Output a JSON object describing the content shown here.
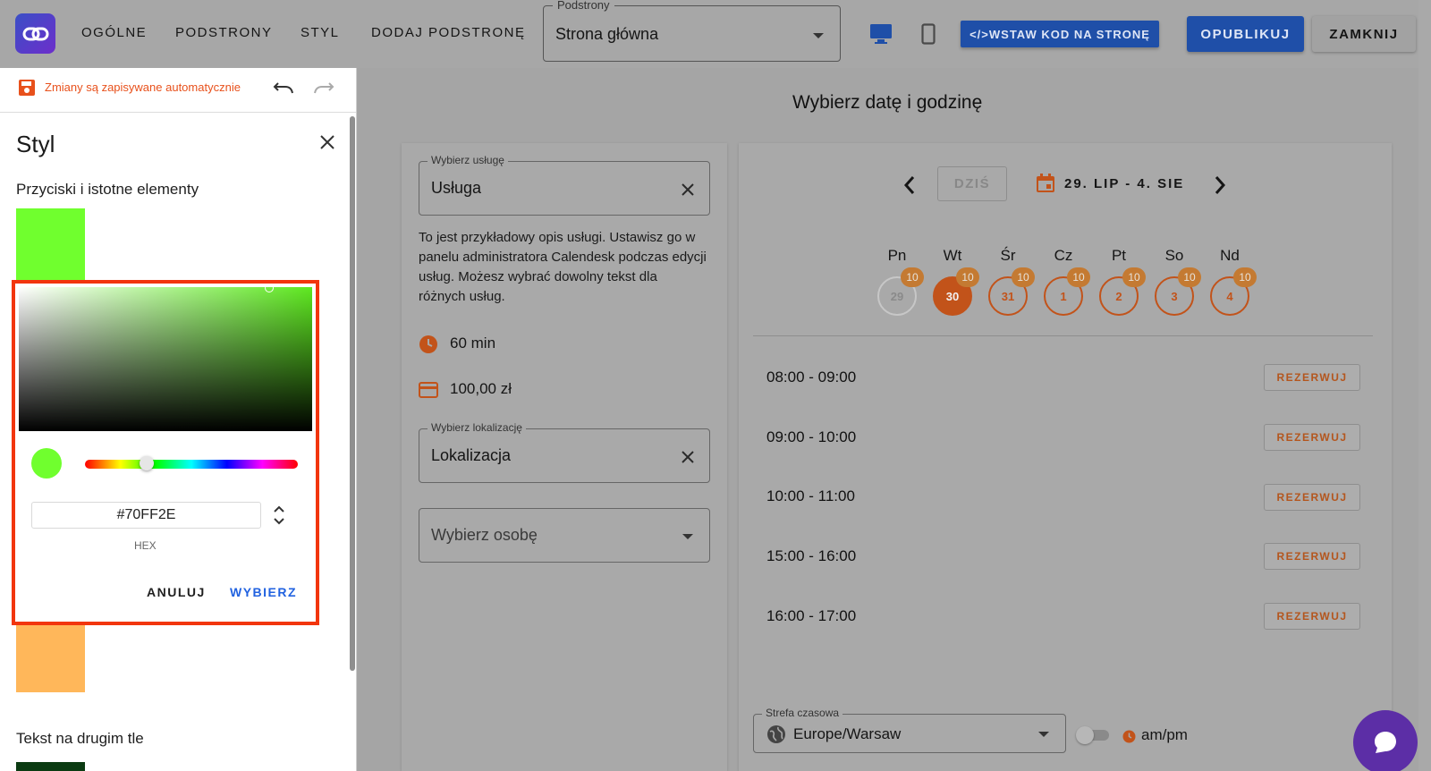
{
  "topbar": {
    "nav": [
      "OGÓLNE",
      "PODSTRONY",
      "STYL",
      "DODAJ PODSTRONĘ"
    ],
    "pages_select": {
      "legend": "Podstrony",
      "value": "Strona główna"
    },
    "embed_label": "</>WSTAW KOD NA STRONĘ",
    "publish_label": "OPUBLIKUJ",
    "close_label": "ZAMKNIJ"
  },
  "left_panel": {
    "autosave_text": "Zmiany są zapisywane automatycznie",
    "title": "Styl",
    "section1_label": "Przyciski i istotne elementy",
    "section2_label": "Tekst na drugim tle",
    "swatch_colors": {
      "primary": "#70ff2e",
      "secondary": "#ffb75a",
      "text_bg": "#0b3b12"
    }
  },
  "color_picker": {
    "hex_value": "#70FF2E",
    "hex_label": "HEX",
    "cancel_label": "ANULUJ",
    "select_label": "WYBIERZ"
  },
  "main": {
    "title": "Wybierz datę i godzinę",
    "service_select": {
      "legend": "Wybierz usługę",
      "value": "Usługa"
    },
    "service_description": "To jest przykładowy opis usługi. Ustawisz go w panelu administratora Calendesk podczas edycji usług. Możesz wybrać dowolny tekst dla różnych usług.",
    "duration": "60 min",
    "price": "100,00 zł",
    "location_select": {
      "legend": "Wybierz lokalizację",
      "value": "Lokalizacja"
    },
    "person_select": {
      "value": "Wybierz osobę"
    }
  },
  "calendar": {
    "today_label": "DZIŚ",
    "range": "29. LIP - 4. SIE",
    "days": [
      {
        "label": "Pn",
        "date": "29",
        "badge": "10"
      },
      {
        "label": "Wt",
        "date": "30",
        "badge": "10"
      },
      {
        "label": "Śr",
        "date": "31",
        "badge": "10"
      },
      {
        "label": "Cz",
        "date": "1",
        "badge": "10"
      },
      {
        "label": "Pt",
        "date": "2",
        "badge": "10"
      },
      {
        "label": "So",
        "date": "3",
        "badge": "10"
      },
      {
        "label": "Nd",
        "date": "4",
        "badge": "10"
      }
    ],
    "slots": [
      {
        "time": "08:00 - 09:00",
        "button": "REZERWUJ"
      },
      {
        "time": "09:00 - 10:00",
        "button": "REZERWUJ"
      },
      {
        "time": "10:00 - 11:00",
        "button": "REZERWUJ"
      },
      {
        "time": "15:00 - 16:00",
        "button": "REZERWUJ"
      },
      {
        "time": "16:00 - 17:00",
        "button": "REZERWUJ"
      }
    ],
    "timezone": {
      "legend": "Strefa czasowa",
      "value": "Europe/Warsaw"
    },
    "ampm_label": "am/pm"
  },
  "colors": {
    "accent_orange": "#c2531a",
    "brand_blue": "#1f4fa8",
    "highlight_red": "#f2350d",
    "chat_purple": "#5c2ea6"
  }
}
